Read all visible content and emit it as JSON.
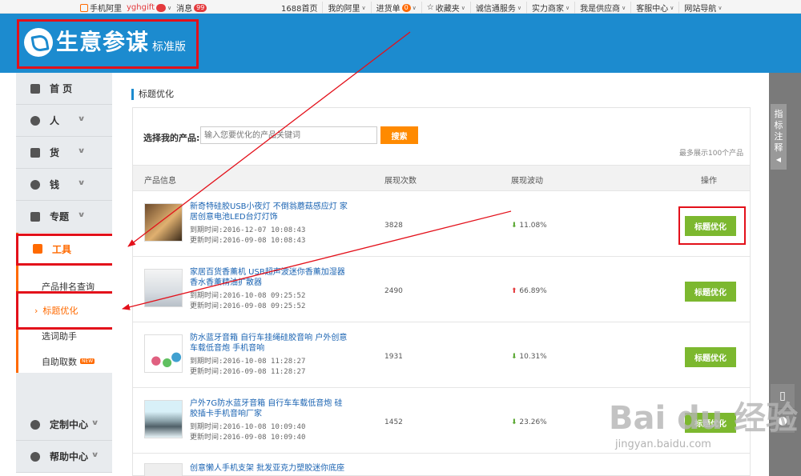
{
  "topbar": {
    "items_left": [
      "手机阿里",
      "yghgift",
      "消息"
    ],
    "msg_count": "99",
    "items_right": [
      "1688首页",
      "我的阿里",
      "进货单",
      "收藏夹",
      "诚信通服务",
      "实力商家",
      "我是供应商",
      "客服中心",
      "网站导航"
    ],
    "cart_count": "0"
  },
  "header": {
    "title": "生意参谋",
    "edition": "标准版"
  },
  "sidebar": {
    "home": "首 页",
    "people": "人",
    "goods": "货",
    "money": "钱",
    "topic": "专题",
    "tools": "工具",
    "sub_items": [
      "产品排名查询",
      "标题优化",
      "选词助手",
      "自助取数"
    ],
    "new_badge": "NEW",
    "custom": "定制中心",
    "help": "帮助中心"
  },
  "main": {
    "page_title": "标题优化",
    "search_label": "选择我的产品:",
    "search_placeholder": "输入您要优化的产品关键词",
    "search_button": "搜索",
    "max_note": "最多展示100个产品",
    "columns": [
      "产品信息",
      "展现次数",
      "展现波动",
      "操作"
    ],
    "action_label": "标题优化",
    "rows": [
      {
        "title": "新奇特硅胶USB小夜灯 不倒翁蘑菇感应灯 家居创意电池LED台灯灯饰",
        "expire": "到期时间:2016-12-07 10:08:43",
        "update": "更新时间:2016-09-08 10:08:43",
        "impressions": "3828",
        "trend_dir": "down",
        "trend": "11.08%"
      },
      {
        "title": "家居百货香薰机 USB超声波迷你香薰加湿器 香水香薰精油扩散器",
        "expire": "到期时间:2016-10-08 09:25:52",
        "update": "更新时间:2016-09-08 09:25:52",
        "impressions": "2490",
        "trend_dir": "up",
        "trend": "66.89%"
      },
      {
        "title": "防水蓝牙音箱 自行车挂绳硅胶音响 户外创意车载低音炮 手机音响",
        "expire": "到期时间:2016-10-08 11:28:27",
        "update": "更新时间:2016-09-08 11:28:27",
        "impressions": "1931",
        "trend_dir": "down",
        "trend": "10.31%"
      },
      {
        "title": "户外7G防水蓝牙音箱 自行车车载低音炮 硅胶插卡手机音响厂家",
        "expire": "到期时间:2016-10-08 10:09:40",
        "update": "更新时间:2016-09-08 10:09:40",
        "impressions": "1452",
        "trend_dir": "down",
        "trend": "23.26%"
      },
      {
        "title": "创意懒人手机支架 批发亚克力塑胶迷你底座",
        "expire": "",
        "update": "",
        "impressions": "",
        "trend_dir": "",
        "trend": ""
      }
    ]
  },
  "rail": {
    "tab_text": "指标注释"
  },
  "watermark": {
    "main": "Bai du 经验",
    "sub": "jingyan.baidu.com"
  },
  "colors": {
    "header_blue": "#1c8bcf",
    "accent_orange": "#ff6a00",
    "button_green": "#7cb82f",
    "annotation_red": "#e3101a"
  }
}
